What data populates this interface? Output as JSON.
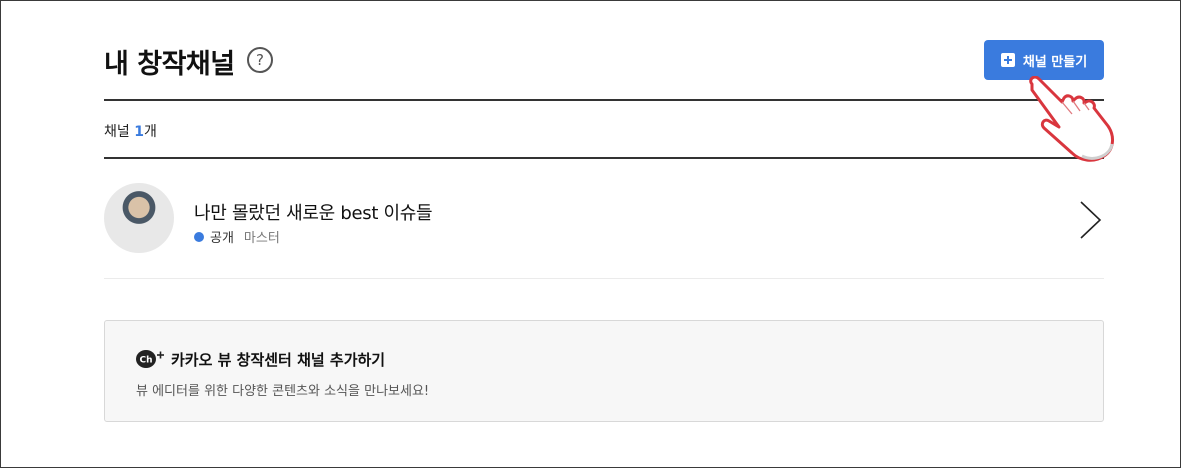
{
  "header": {
    "title": "내 창작채널",
    "help_label": "?",
    "create_button_label": "채널 만들기"
  },
  "summary": {
    "label": "채널 ",
    "count": "1",
    "unit": "개"
  },
  "channels": [
    {
      "name": "나만 몰랐던 새로운 best 이슈들",
      "status": "공개",
      "role": "마스터"
    }
  ],
  "promo": {
    "title": "카카오 뷰 창작센터 채널 추가하기",
    "description": "뷰 에디터를 위한 다양한 콘텐츠와 소식을 만나보세요!",
    "badge_text": "Ch"
  },
  "colors": {
    "accent": "#3a7bde",
    "pointer_outline": "#d9363e"
  },
  "icons": {
    "help": "question-circle-icon",
    "plus": "plus-square-icon",
    "chevron": "chevron-right-icon",
    "channel_badge": "kakao-channel-icon",
    "pointer": "pointing-hand-icon"
  }
}
